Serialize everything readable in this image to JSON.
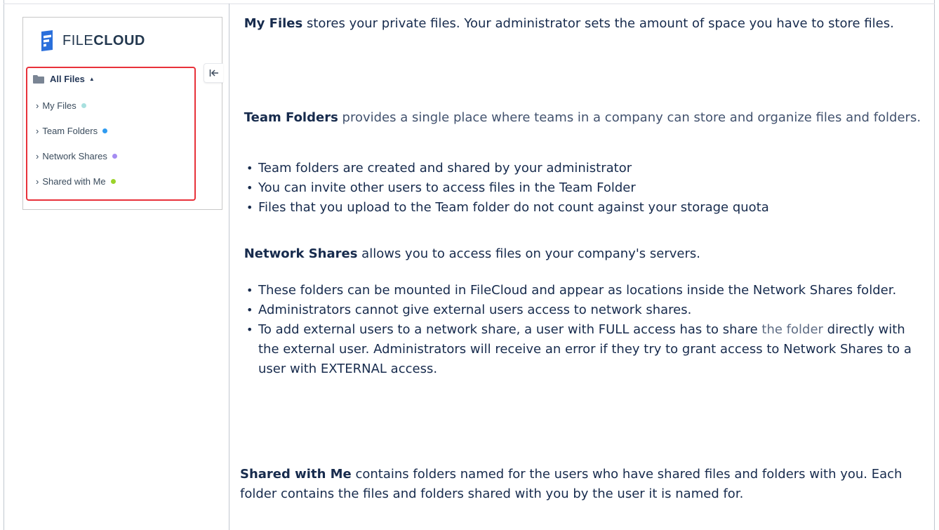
{
  "screenshot": {
    "logo": {
      "text_thin": "FILE",
      "text_bold": "CLOUD"
    },
    "collapse_icon": "collapse-left-icon",
    "nav": {
      "root_label": "All Files",
      "root_icon": "folder-icon",
      "items": [
        {
          "label": "My Files",
          "dot_color": "#a8e0df"
        },
        {
          "label": "Team Folders",
          "dot_color": "#2f9bf0"
        },
        {
          "label": "Network Shares",
          "dot_color": "#a58cf2"
        },
        {
          "label": "Shared with Me",
          "dot_color": "#9bd32a"
        }
      ]
    },
    "highlight_color": "#e8313a"
  },
  "content": {
    "my_files": {
      "title": "My Files",
      "text": " stores your private files. Your administrator sets the amount of space you have to store files."
    },
    "team_folders": {
      "title": "Team Folders",
      "text": " provides a single place where teams in a company can store and organize files and folders.",
      "bullets": [
        "Team folders are created and shared by your administrator",
        "You can invite other users to access files in the Team Folder",
        "Files that you upload to the Team folder do not count against your storage quota"
      ]
    },
    "network_shares": {
      "title": "Network Shares",
      "text": " allows you to access files on your company's servers.",
      "bullets": [
        "These folders can be mounted in FileCloud and appear as locations inside the Network Shares folder.",
        "Administrators cannot give external users access to network shares."
      ],
      "bullet3_pre": "To add external users to a network share, a user with FULL access has to share ",
      "bullet3_link": "the folder",
      "bullet3_post": " directly with the external user. Administrators will receive an error if they try to grant access to Network Shares to a user with EXTERNAL access."
    },
    "shared_with_me": {
      "title": "Shared with Me",
      "text": " contains folders named for the users who have shared files and folders with you. Each folder contains the files and folders shared with you by the user it is named for."
    }
  }
}
